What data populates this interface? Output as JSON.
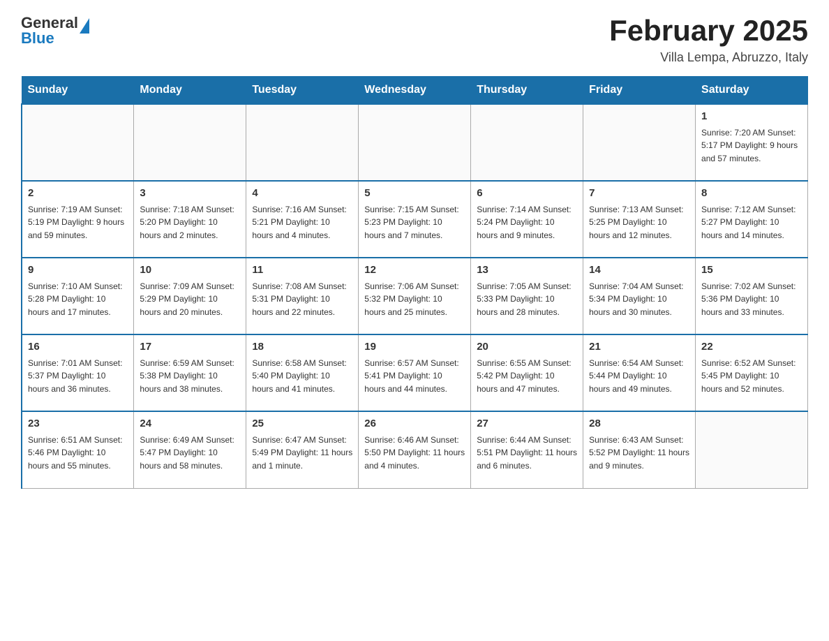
{
  "header": {
    "logo_general": "General",
    "logo_blue": "Blue",
    "title": "February 2025",
    "subtitle": "Villa Lempa, Abruzzo, Italy"
  },
  "days_of_week": [
    "Sunday",
    "Monday",
    "Tuesday",
    "Wednesday",
    "Thursday",
    "Friday",
    "Saturday"
  ],
  "weeks": [
    {
      "days": [
        {
          "number": "",
          "info": ""
        },
        {
          "number": "",
          "info": ""
        },
        {
          "number": "",
          "info": ""
        },
        {
          "number": "",
          "info": ""
        },
        {
          "number": "",
          "info": ""
        },
        {
          "number": "",
          "info": ""
        },
        {
          "number": "1",
          "info": "Sunrise: 7:20 AM\nSunset: 5:17 PM\nDaylight: 9 hours and 57 minutes."
        }
      ]
    },
    {
      "days": [
        {
          "number": "2",
          "info": "Sunrise: 7:19 AM\nSunset: 5:19 PM\nDaylight: 9 hours and 59 minutes."
        },
        {
          "number": "3",
          "info": "Sunrise: 7:18 AM\nSunset: 5:20 PM\nDaylight: 10 hours and 2 minutes."
        },
        {
          "number": "4",
          "info": "Sunrise: 7:16 AM\nSunset: 5:21 PM\nDaylight: 10 hours and 4 minutes."
        },
        {
          "number": "5",
          "info": "Sunrise: 7:15 AM\nSunset: 5:23 PM\nDaylight: 10 hours and 7 minutes."
        },
        {
          "number": "6",
          "info": "Sunrise: 7:14 AM\nSunset: 5:24 PM\nDaylight: 10 hours and 9 minutes."
        },
        {
          "number": "7",
          "info": "Sunrise: 7:13 AM\nSunset: 5:25 PM\nDaylight: 10 hours and 12 minutes."
        },
        {
          "number": "8",
          "info": "Sunrise: 7:12 AM\nSunset: 5:27 PM\nDaylight: 10 hours and 14 minutes."
        }
      ]
    },
    {
      "days": [
        {
          "number": "9",
          "info": "Sunrise: 7:10 AM\nSunset: 5:28 PM\nDaylight: 10 hours and 17 minutes."
        },
        {
          "number": "10",
          "info": "Sunrise: 7:09 AM\nSunset: 5:29 PM\nDaylight: 10 hours and 20 minutes."
        },
        {
          "number": "11",
          "info": "Sunrise: 7:08 AM\nSunset: 5:31 PM\nDaylight: 10 hours and 22 minutes."
        },
        {
          "number": "12",
          "info": "Sunrise: 7:06 AM\nSunset: 5:32 PM\nDaylight: 10 hours and 25 minutes."
        },
        {
          "number": "13",
          "info": "Sunrise: 7:05 AM\nSunset: 5:33 PM\nDaylight: 10 hours and 28 minutes."
        },
        {
          "number": "14",
          "info": "Sunrise: 7:04 AM\nSunset: 5:34 PM\nDaylight: 10 hours and 30 minutes."
        },
        {
          "number": "15",
          "info": "Sunrise: 7:02 AM\nSunset: 5:36 PM\nDaylight: 10 hours and 33 minutes."
        }
      ]
    },
    {
      "days": [
        {
          "number": "16",
          "info": "Sunrise: 7:01 AM\nSunset: 5:37 PM\nDaylight: 10 hours and 36 minutes."
        },
        {
          "number": "17",
          "info": "Sunrise: 6:59 AM\nSunset: 5:38 PM\nDaylight: 10 hours and 38 minutes."
        },
        {
          "number": "18",
          "info": "Sunrise: 6:58 AM\nSunset: 5:40 PM\nDaylight: 10 hours and 41 minutes."
        },
        {
          "number": "19",
          "info": "Sunrise: 6:57 AM\nSunset: 5:41 PM\nDaylight: 10 hours and 44 minutes."
        },
        {
          "number": "20",
          "info": "Sunrise: 6:55 AM\nSunset: 5:42 PM\nDaylight: 10 hours and 47 minutes."
        },
        {
          "number": "21",
          "info": "Sunrise: 6:54 AM\nSunset: 5:44 PM\nDaylight: 10 hours and 49 minutes."
        },
        {
          "number": "22",
          "info": "Sunrise: 6:52 AM\nSunset: 5:45 PM\nDaylight: 10 hours and 52 minutes."
        }
      ]
    },
    {
      "days": [
        {
          "number": "23",
          "info": "Sunrise: 6:51 AM\nSunset: 5:46 PM\nDaylight: 10 hours and 55 minutes."
        },
        {
          "number": "24",
          "info": "Sunrise: 6:49 AM\nSunset: 5:47 PM\nDaylight: 10 hours and 58 minutes."
        },
        {
          "number": "25",
          "info": "Sunrise: 6:47 AM\nSunset: 5:49 PM\nDaylight: 11 hours and 1 minute."
        },
        {
          "number": "26",
          "info": "Sunrise: 6:46 AM\nSunset: 5:50 PM\nDaylight: 11 hours and 4 minutes."
        },
        {
          "number": "27",
          "info": "Sunrise: 6:44 AM\nSunset: 5:51 PM\nDaylight: 11 hours and 6 minutes."
        },
        {
          "number": "28",
          "info": "Sunrise: 6:43 AM\nSunset: 5:52 PM\nDaylight: 11 hours and 9 minutes."
        },
        {
          "number": "",
          "info": ""
        }
      ]
    }
  ]
}
